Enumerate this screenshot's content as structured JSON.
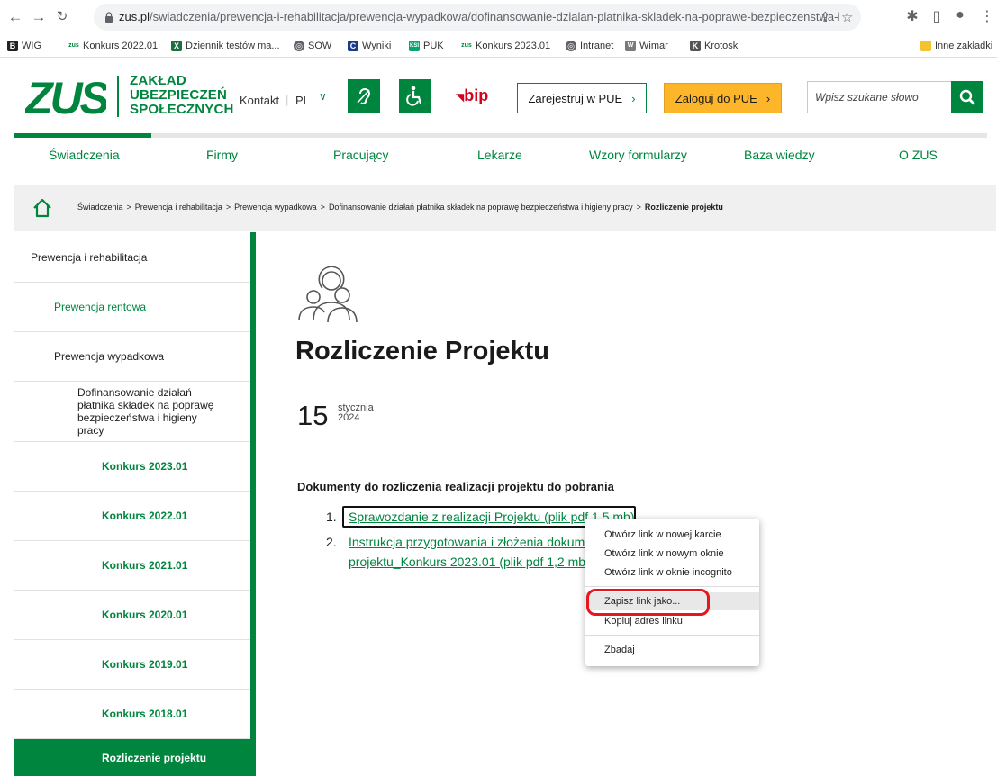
{
  "browser": {
    "url_host": "zus.pl",
    "url_path": "/swiadczenia/prewencja-i-rehabilitacja/prewencja-wypadkowa/dofinansowanie-dzialan-platnika-skladek-na-poprawe-bezpieczenstwa-i-...",
    "bookmarks": [
      {
        "label": "WIG",
        "icon": "B",
        "color": "#222"
      },
      {
        "label": "Konkurs 2022.01",
        "icon": "zus",
        "color": "#00853f"
      },
      {
        "label": "Dziennik testów ma...",
        "icon": "X",
        "color": "#1d6f42"
      },
      {
        "label": "SOW",
        "icon": "globe",
        "color": "#5f6368"
      },
      {
        "label": "Wyniki",
        "icon": "C",
        "color": "#1a3a8a"
      },
      {
        "label": "PUK",
        "icon": "KSI",
        "color": "#00a86b"
      },
      {
        "label": "Konkurs 2023.01",
        "icon": "zus",
        "color": "#00853f"
      },
      {
        "label": "Intranet",
        "icon": "globe",
        "color": "#5f6368"
      },
      {
        "label": "Wimar",
        "icon": "W",
        "color": "#7a7a7a"
      },
      {
        "label": "Krotoski",
        "icon": "K",
        "color": "#555"
      }
    ],
    "other_bookmarks": "Inne zakładki"
  },
  "header": {
    "logo": "ZUS",
    "logo_text_1": "ZAKŁAD",
    "logo_text_2": "UBEZPIECZEŃ",
    "logo_text_3": "SPOŁECZNYCH",
    "kontakt": "Kontakt",
    "lang": "PL",
    "bip": "bip",
    "register_btn": "Zarejestruj w PUE",
    "login_btn": "Zaloguj do PUE",
    "search_placeholder": "Wpisz szukane słowo",
    "accent": "#00853f",
    "login_color": "#fdb52a"
  },
  "nav": {
    "items": [
      "Świadczenia",
      "Firmy",
      "Pracujący",
      "Lekarze",
      "Wzory formularzy",
      "Baza wiedzy",
      "O ZUS"
    ]
  },
  "breadcrumb": {
    "items": [
      "Świadczenia",
      "Prewencja i rehabilitacja",
      "Prewencja wypadkowa",
      "Dofinansowanie działań płatnika składek na poprawę bezpieczeństwa i higieny pracy"
    ],
    "current": "Rozliczenie projektu"
  },
  "sidebar": {
    "items": [
      "Prewencja i rehabilitacja",
      "Prewencja rentowa",
      "Prewencja wypadkowa",
      "Dofinansowanie działań płatnika składek na poprawę bezpieczeństwa i higieny pracy",
      "Konkurs 2023.01",
      "Konkurs 2022.01",
      "Konkurs 2021.01",
      "Konkurs 2020.01",
      "Konkurs 2019.01",
      "Konkurs 2018.01",
      "Rozliczenie projektu"
    ]
  },
  "content": {
    "title": "Rozliczenie Projektu",
    "date_day": "15",
    "date_month": "stycznia",
    "date_year": "2024",
    "docs_heading": "Dokumenty do rozliczenia realizacji projektu do pobrania",
    "doc1_num": "1.",
    "doc1": "Sprawozdanie z realizacji Projektu (plik pdf 1,5 mb)",
    "doc2_num": "2.",
    "doc2_line1": "Instrukcja przygotowania i złożenia dokumentów do rozliczenia realizacji",
    "doc2_line2": "projektu_Konkurs 2023.01 (plik pdf 1,2 mb)"
  },
  "context_menu": {
    "items": [
      "Otwórz link w nowej karcie",
      "Otwórz link w nowym oknie",
      "Otwórz link w oknie incognito",
      "Zapisz link jako...",
      "Kopiuj adres linku",
      "Zbadaj"
    ],
    "highlight_color": "#e8151c"
  }
}
